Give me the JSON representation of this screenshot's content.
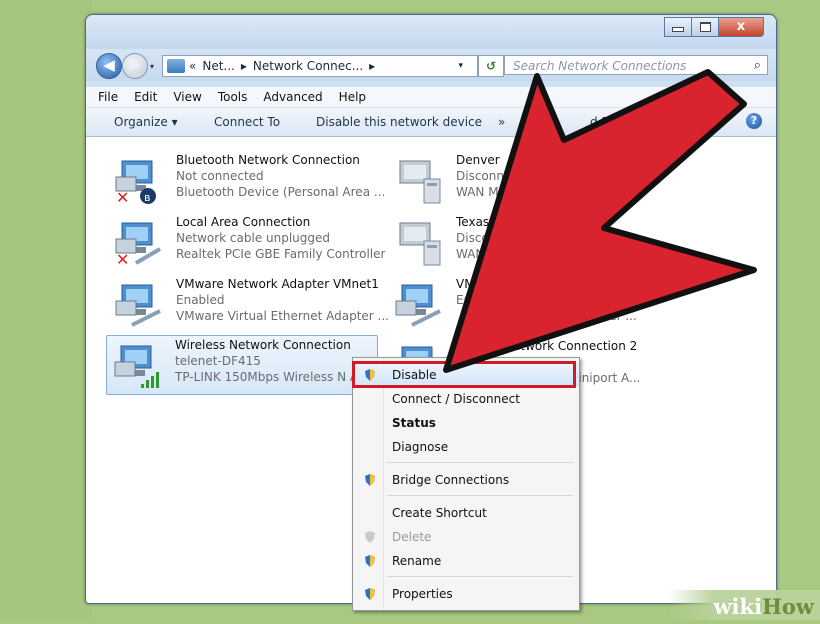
{
  "window": {
    "close_glyph": "x",
    "back_glyph": "◀",
    "forward_glyph": "▶"
  },
  "address": {
    "parts": [
      "«",
      "Net...",
      "▸",
      "Network Connec...",
      "▸"
    ],
    "dropdown_glyph": "▾",
    "refresh_glyph": "↺"
  },
  "search": {
    "placeholder": "Search Network Connections",
    "icon": "magnifier-icon"
  },
  "menu": [
    "File",
    "Edit",
    "View",
    "Tools",
    "Advanced",
    "Help"
  ],
  "toolbar": {
    "organize": "Organize ▾",
    "connect_to": "Connect To",
    "disable_device": "Disable this network device",
    "more": "»",
    "partial": "d File",
    "help": "?"
  },
  "connections": [
    {
      "name": "Bluetooth Network Connection",
      "status": "Not connected",
      "device": "Bluetooth Device (Personal Area ...",
      "state": "error",
      "badge": "bluetooth"
    },
    {
      "name": "Local Area Connection",
      "status": "Network cable unplugged",
      "device": "Realtek PCIe GBE Family Controller",
      "state": "error",
      "badge": "cable"
    },
    {
      "name": "VMware Network Adapter VMnet1",
      "status": "Enabled",
      "device": "VMware Virtual Ethernet Adapter ...",
      "state": "ok",
      "badge": "cable"
    },
    {
      "name": "Wireless Network Connection",
      "status": "telenet-DF415",
      "device": "TP-LINK 150Mbps Wireless N A...",
      "state": "selected",
      "badge": "signal"
    },
    {
      "name": "Denver",
      "status": "Disconne",
      "device": "WAN M",
      "state": "wan"
    },
    {
      "name": "Texas",
      "status": "Disco",
      "device": "WAN",
      "state": "wan"
    },
    {
      "name": "VM",
      "status": "En",
      "device": "et Adapter ...",
      "state": "ok"
    },
    {
      "name": "Network Connection 2",
      "status": "",
      "device": "Miniport A...",
      "state": "ok"
    }
  ],
  "context_menu": {
    "items": [
      {
        "label": "Disable",
        "shield": true,
        "highlight": true
      },
      {
        "label": "Connect / Disconnect",
        "shield": false
      },
      {
        "label": "Status",
        "shield": false,
        "bold": true
      },
      {
        "label": "Diagnose",
        "shield": false
      },
      {
        "label": "Bridge Connections",
        "shield": true
      },
      {
        "label": "Create Shortcut",
        "shield": false
      },
      {
        "label": "Delete",
        "shield": true,
        "disabled": true
      },
      {
        "label": "Rename",
        "shield": true
      },
      {
        "label": "Properties",
        "shield": true
      }
    ]
  },
  "watermark": {
    "wiki": "wiki",
    "how": "How"
  },
  "colors": {
    "arrow": "#d9232e",
    "highlight_box": "#d01b27",
    "background": "#a9c983",
    "selection": "#d6e7f8"
  }
}
